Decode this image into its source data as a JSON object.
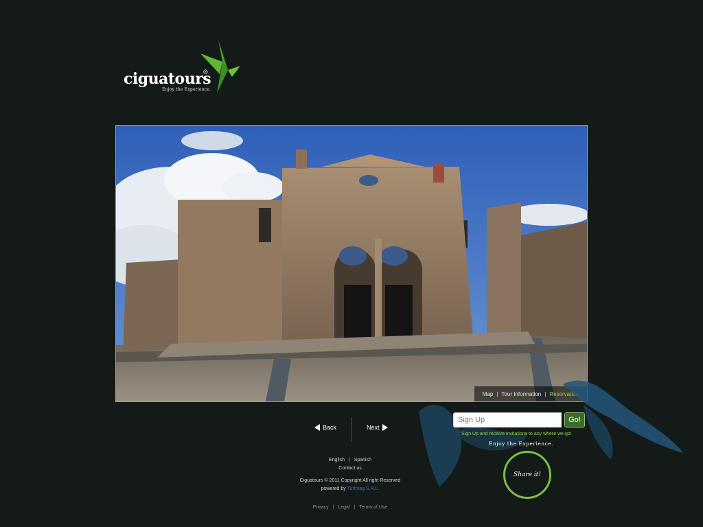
{
  "brand": {
    "name": "ciguatours",
    "registered_mark": "®",
    "tagline": "Enjoy the Experience.",
    "bird_color": "#5fb832"
  },
  "photo_nav": {
    "items": [
      {
        "label": "Map",
        "active": false
      },
      {
        "label": "Tour Information",
        "active": false
      },
      {
        "label": "Reservation",
        "active": true
      }
    ],
    "separator": "|"
  },
  "pager": {
    "back_label": "Back",
    "next_label": "Next"
  },
  "signup": {
    "placeholder": "Sign Up",
    "button_label": "Go!",
    "note": "Sign Up and receive invitations to any where we go!",
    "tagline": "Enjoy the Experience."
  },
  "share": {
    "label": "Share it!"
  },
  "footer": {
    "languages": [
      "English",
      "Spanish"
    ],
    "contact": "Contact us",
    "copyright": "Ciguatours © 2011 Copyright All right Reserved",
    "powered_prefix": "powered by",
    "powered_by": "Turimag S.R.L.",
    "legal_links": [
      "Privacy",
      "Legal",
      "Terms of Use"
    ],
    "separator": "|"
  },
  "colors": {
    "background": "#141a17",
    "accent_green": "#79c142",
    "active_link": "#8ccf4d",
    "link_blue": "#2f7bc0"
  }
}
